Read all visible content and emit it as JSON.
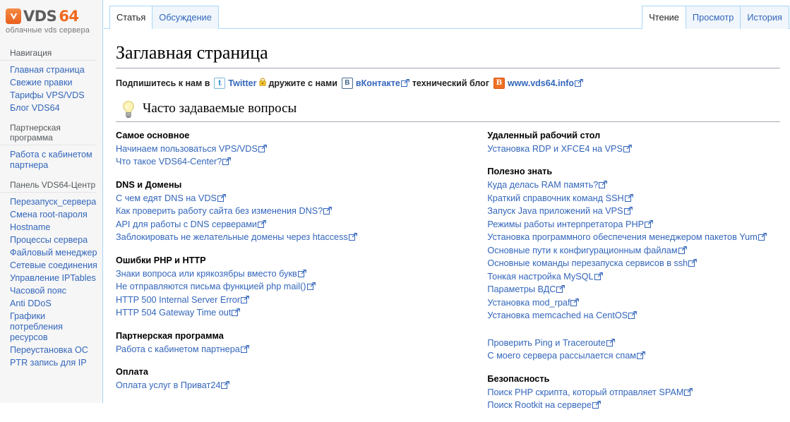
{
  "brand": {
    "name_part1": "VDS",
    "name_part2": "64",
    "tagline": "облачные vds сервера",
    "mark_color": "#ef6a1e"
  },
  "tabs": {
    "left": [
      {
        "label": "Статья",
        "selected": true
      },
      {
        "label": "Обсуждение",
        "selected": false
      }
    ],
    "right": [
      {
        "label": "Чтение",
        "selected": true
      },
      {
        "label": "Просмотр",
        "selected": false
      },
      {
        "label": "История",
        "selected": false
      }
    ]
  },
  "sidebar": {
    "portlets": [
      {
        "title": "Навигация",
        "items": [
          "Главная страница",
          "Свежие правки",
          "Тарифы VPS/VDS",
          "Блог VDS64"
        ]
      },
      {
        "title": "Партнерская программа",
        "items": [
          "Работа с кабинетом партнера"
        ]
      },
      {
        "title": "Панель VDS64-Центр",
        "items": [
          "Перезапуск_сервера",
          "Смена root-пароля",
          "Hostname",
          "Процессы сервера",
          "Файловый менеджер",
          "Сетевые соединения",
          "Управление IPTables",
          "Часовой пояс",
          "Anti DDoS",
          "Графики потребления ресурсов",
          "Переустановка ОС",
          "PTR запись для IP"
        ]
      }
    ]
  },
  "page": {
    "title": "Заглавная страница"
  },
  "subscribe": {
    "lead": "Подпишитесь к нам в",
    "twitter_label": "Twitter",
    "twitter_icon": "twitter-icon",
    "lock_icon": "lock-icon",
    "middle": "дружите с нами",
    "vk_label": "вКонтакте",
    "vk_icon": "vkontakte-icon",
    "blog_text": "технический блог",
    "blogger_icon": "blogger-icon",
    "site_label": "www.vds64.info"
  },
  "faq": {
    "icon": "lightbulb-icon",
    "heading": "Часто задаваемые вопросы"
  },
  "columns": {
    "left": [
      {
        "title": "Самое основное",
        "links": [
          "Начинаем пользоваться VPS/VDS",
          "Что такое VDS64-Center?"
        ]
      },
      {
        "title": "DNS и Домены",
        "links": [
          "С чем едят DNS на VDS",
          "Как проверить работу сайта без изменения DNS?",
          "API для работы с DNS серверами",
          "Заблокировать не желательные домены через htaccess"
        ]
      },
      {
        "title": "Ошибки PHP и HTTP",
        "links": [
          "Знаки вопроса или крякозябры вместо букв",
          "Не отправляются письма функцией php mail()",
          "HTTP 500 Internal Server Error",
          "HTTP 504 Gateway Time out"
        ]
      },
      {
        "title": "Партнерская программа",
        "links": [
          "Работа с кабинетом партнера"
        ]
      },
      {
        "title": "Оплата",
        "links": [
          "Оплата услуг в Приват24"
        ]
      }
    ],
    "right": [
      {
        "title": "Удаленный рабочий стол",
        "links": [
          "Установка RDP и XFCE4 на VPS"
        ]
      },
      {
        "title": "Полезно знать",
        "links": [
          "Куда делась RAM память?",
          "Краткий справочник команд SSH",
          "Запуск Java приложений на VPS",
          "Режимы работы интерпретатора PHP",
          "Установка программного обеспечения менеджером пакетов Yum",
          "Основные пути к конфигурационным файлам",
          "Основные команды перезапуска сервисов в ssh",
          "Тонкая настройка MySQL",
          "Параметры ВДС",
          "Установка mod_rpaf",
          "Установка memcached на CentOS"
        ]
      },
      {
        "title": "",
        "links": [
          "Проверить Ping и Traceroute",
          "С моего сервера рассылается спам"
        ]
      },
      {
        "title": "Безопасность",
        "links": [
          "Поиск PHP скрипта, который отправляет SPAM",
          "Поиск Rootkit на сервере"
        ]
      }
    ]
  },
  "colors": {
    "link": "#3366bb",
    "tab_border": "#a7d7f9",
    "sidebar_bg": "#f6f6f6",
    "rule": "#a2a9b1"
  }
}
